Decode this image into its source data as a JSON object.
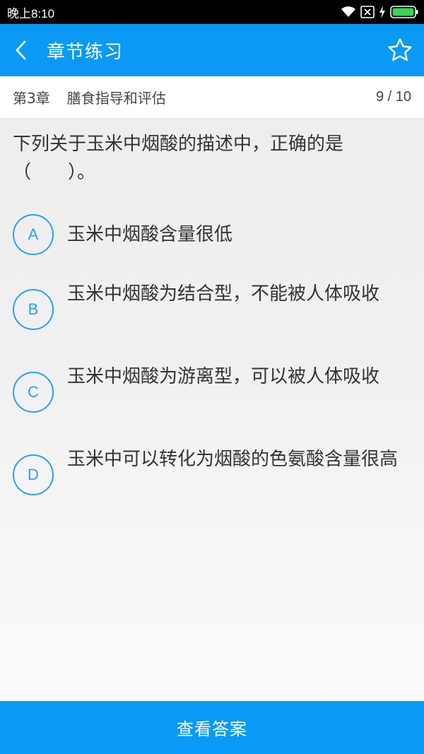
{
  "status_bar": {
    "time": "晚上8:10"
  },
  "header": {
    "title": "章节练习",
    "back_icon": "chevron-left-icon",
    "favorite_icon": "star-outline-icon"
  },
  "chapter_bar": {
    "chapter": "第3章",
    "chapter_name": "膳食指导和评估",
    "progress": "9 / 10"
  },
  "question": {
    "text": "下列关于玉米中烟酸的描述中，正确的是（　　）。"
  },
  "options": [
    {
      "letter": "A",
      "text": "玉米中烟酸含量很低"
    },
    {
      "letter": "B",
      "text": "玉米中烟酸为结合型，不能被人体吸收"
    },
    {
      "letter": "C",
      "text": "玉米中烟酸为游离型，可以被人体吸收"
    },
    {
      "letter": "D",
      "text": "玉米中可以转化为烟酸的色氨酸含量很高"
    }
  ],
  "footer": {
    "view_answer_label": "查看答案"
  },
  "colors": {
    "accent": "#0a9af5",
    "option_circle": "#2b9ff2"
  }
}
